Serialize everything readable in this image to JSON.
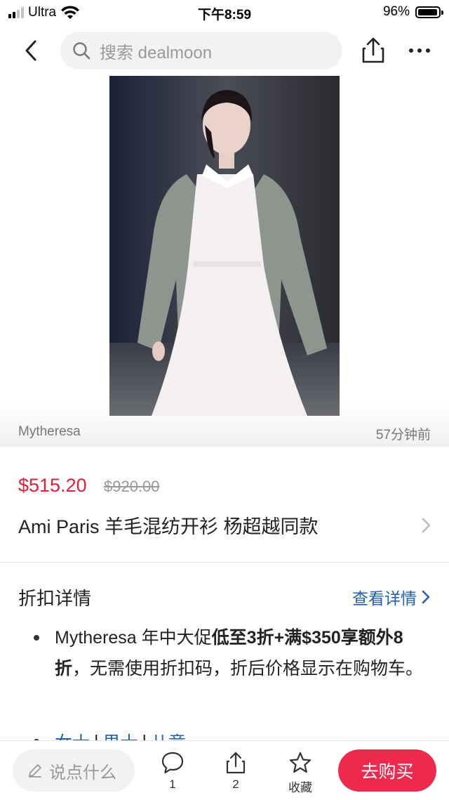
{
  "status_bar": {
    "carrier": "Ultra",
    "time": "下午8:59",
    "battery": "96%",
    "battery_level": 0.96
  },
  "nav": {
    "search_placeholder": "搜索 dealmoon"
  },
  "hero": {
    "source": "Mytheresa",
    "time_ago": "57分钟前"
  },
  "product": {
    "price": "$515.20",
    "original_price": "$920.00",
    "title": "Ami Paris 羊毛混纺开衫 杨超越同款"
  },
  "deal": {
    "heading": "折扣详情",
    "detail_link": "查看详情",
    "text_part1": "Mytheresa 年中大促",
    "text_bold": "低至3折+满$350享额外8折",
    "text_part2": "，无需使用折扣码，折后价格显示在购物车。",
    "tags": [
      "女士",
      "男士",
      "儿童"
    ]
  },
  "bottom_bar": {
    "comment_placeholder": "说点什么",
    "comment_count": "1",
    "share_count": "2",
    "favorite_label": "收藏",
    "buy_label": "去购买"
  },
  "colors": {
    "price_red": "#e0213a",
    "link_blue": "#1f5fae",
    "buy_button": "#ed2a4d"
  }
}
